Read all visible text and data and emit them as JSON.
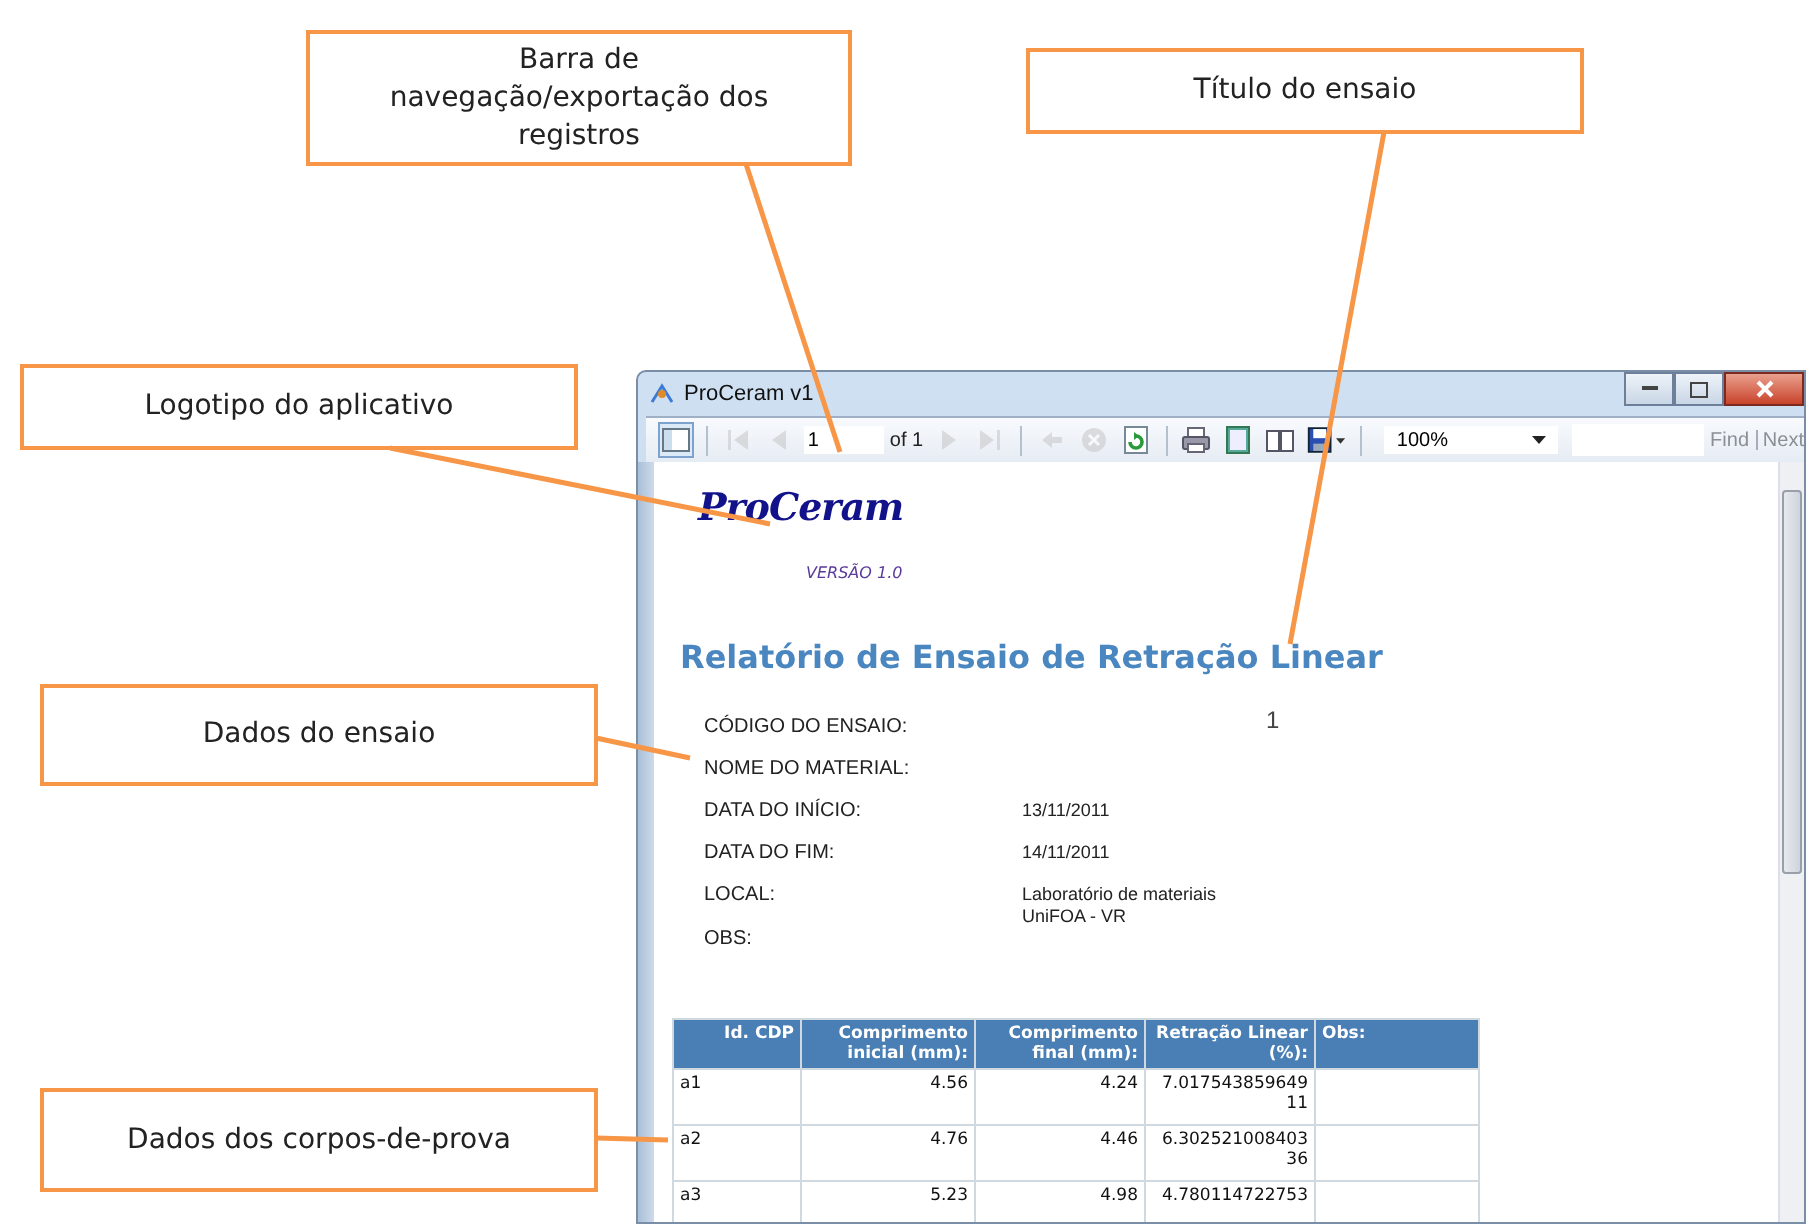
{
  "callouts": [
    {
      "text": "Barra de navegação/exportação dos registros"
    },
    {
      "text": "Título do ensaio"
    },
    {
      "text": "Logotipo do aplicativo"
    },
    {
      "text": "Dados do ensaio"
    },
    {
      "text": "Dados dos corpos-de-prova"
    }
  ],
  "window": {
    "title": "ProCeram v1"
  },
  "toolbar": [
    {
      "kind": "sidebar",
      "disabled": false
    },
    {
      "kind": "first",
      "disabled": true
    },
    {
      "kind": "previous",
      "disabled": true
    },
    {
      "kind": "page",
      "value": "1"
    },
    {
      "kind": "label",
      "text": "of 1"
    },
    {
      "kind": "next",
      "disabled": true
    },
    {
      "kind": "last",
      "disabled": true
    },
    {
      "kind": "back",
      "disabled": true
    },
    {
      "kind": "stop",
      "disabled": true
    },
    {
      "kind": "refresh",
      "disabled": false
    },
    {
      "kind": "print",
      "disabled": false
    },
    {
      "kind": "layout",
      "disabled": false
    },
    {
      "kind": "setup",
      "disabled": false
    },
    {
      "kind": "save",
      "disabled": false
    },
    {
      "kind": "zoom",
      "value": "100%"
    },
    {
      "kind": "search"
    },
    {
      "kind": "link",
      "text": "Find",
      "disabled": true
    },
    {
      "kind": "link",
      "text": "Next",
      "disabled": true
    }
  ],
  "report": {
    "logo": "ProCeram",
    "version": "VERSÃO 1.0",
    "title": "Relatório de Ensaio de Retração Linear",
    "fields": [
      {
        "label": "CÓDIGO DO ENSAIO:",
        "value": "1",
        "kind": "code"
      },
      {
        "label": "NOME DO MATERIAL:"
      },
      {
        "label": "DATA DO INÍCIO:",
        "value": "13/11/2011"
      },
      {
        "label": "DATA DO FIM:",
        "value": "14/11/2011"
      },
      {
        "label": "LOCAL:",
        "value": "Laboratório de materiais\nUniFOA - VR"
      },
      {
        "label": "OBS:"
      }
    ],
    "table": {
      "columns": [
        "Id. CDP",
        "Comprimento inicial (mm):",
        "Comprimento final (mm):",
        "Retração Linear (%):",
        "Obs:"
      ],
      "rows": [
        [
          "a1",
          "4.56",
          "4.24",
          "7.01754385964911"
        ],
        [
          "a2",
          "4.76",
          "4.46",
          "6.30252100840336"
        ],
        [
          "a3",
          "5.23",
          "4.98",
          "4.780114722753"
        ]
      ]
    }
  }
}
